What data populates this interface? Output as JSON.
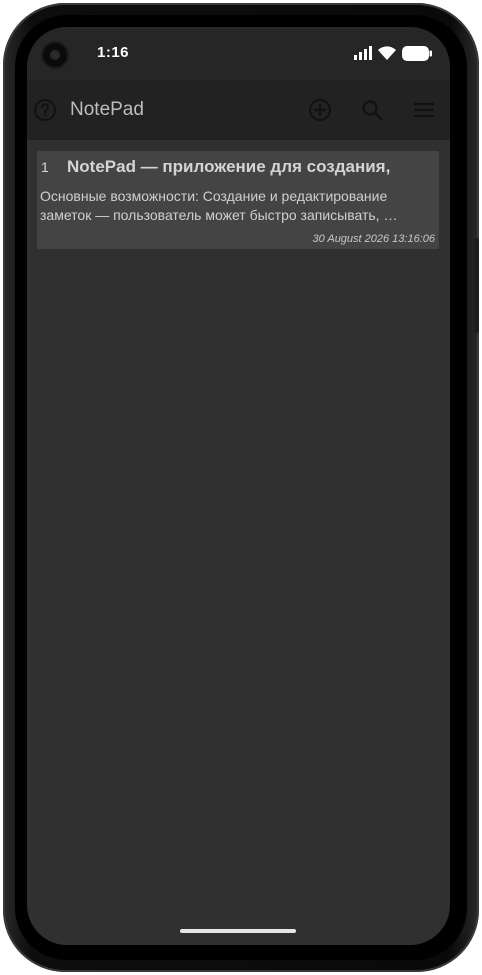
{
  "status_bar": {
    "time": "1:16",
    "icons": [
      "signal-icon",
      "wifi-icon",
      "battery-icon"
    ]
  },
  "app_bar": {
    "title": "NotePad",
    "left_icon": "help-icon",
    "actions": [
      {
        "name": "add-note-button",
        "icon": "add-circle-icon"
      },
      {
        "name": "search-button",
        "icon": "search-icon"
      },
      {
        "name": "menu-button",
        "icon": "menu-icon"
      }
    ]
  },
  "notes": [
    {
      "number": "1",
      "title": "NotePad — приложение для создания,",
      "body": "Основные возможности: Создание и редактирование заметок — пользователь может быстро записывать, …",
      "date": "30 August 2026 13:16:06"
    }
  ],
  "colors": {
    "screen_bg": "#303030",
    "app_bar_bg": "#222222",
    "card_bg": "#444444",
    "text": "#d4d4d4"
  }
}
